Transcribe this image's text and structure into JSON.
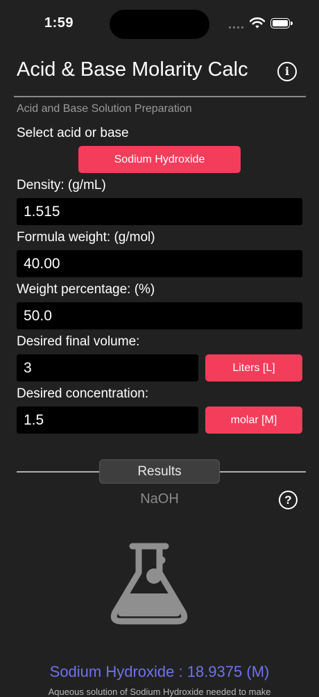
{
  "status_bar": {
    "time": "1:59"
  },
  "header": {
    "title": "Acid & Base Molarity Calc",
    "info_icon": "info-circle-icon"
  },
  "form": {
    "section_label": "Acid and Base Solution Preparation",
    "select_label": "Select acid or base",
    "selected_substance": "Sodium Hydroxide",
    "density_label": "Density:  (g/mL)",
    "density_value": "1.515",
    "formula_weight_label": "Formula weight:  (g/mol)",
    "formula_weight_value": "40.00",
    "weight_pct_label": "Weight percentage:  (%)",
    "weight_pct_value": "50.0",
    "final_volume_label": "Desired final volume:",
    "final_volume_value": "3",
    "volume_unit": "Liters [L]",
    "concentration_label": "Desired concentration:",
    "concentration_value": "1.5",
    "concentration_unit": "molar [M]"
  },
  "results": {
    "tab_label": "Results",
    "formula": "NaOH",
    "help_icon": "question-circle-icon",
    "flask_icon": "flask-icon",
    "result_line": "Sodium Hydroxide : 18.9375 (M)",
    "result_sub": "Aqueous solution of Sodium Hydroxide needed to make"
  },
  "colors": {
    "accent": "#f43d5b",
    "result": "#6f72ea",
    "background": "#212121"
  }
}
